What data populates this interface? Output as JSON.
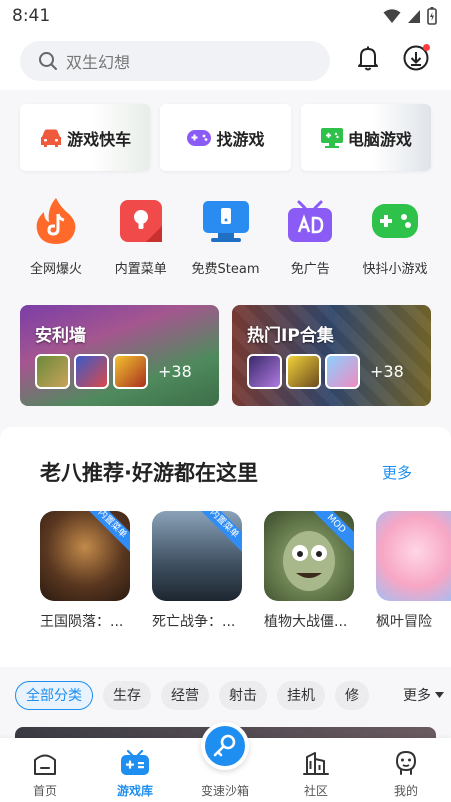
{
  "status_bar": {
    "time": "8:41"
  },
  "search": {
    "placeholder": "双生幻想"
  },
  "feature_cards": [
    {
      "label": "游戏快车",
      "icon": "car-icon",
      "color": "#f05a3c"
    },
    {
      "label": "找游戏",
      "icon": "gamepad-icon",
      "color": "#8a5cf5"
    },
    {
      "label": "电脑游戏",
      "icon": "monitor-gamepad-icon",
      "color": "#2ec24a"
    }
  ],
  "quick_links": [
    {
      "label": "全网爆火",
      "icon": "tiktok-flame-icon",
      "color": "#ff6a2a"
    },
    {
      "label": "内置菜单",
      "icon": "menu-bulb-icon",
      "color": "#f04a4a"
    },
    {
      "label": "免费Steam",
      "icon": "steam-monitor-icon",
      "color": "#2a8cf0"
    },
    {
      "label": "免广告",
      "icon": "no-ads-icon",
      "color": "#8a5cf5"
    },
    {
      "label": "快抖小游戏",
      "icon": "mini-game-icon",
      "color": "#2ec24a"
    }
  ],
  "banners": [
    {
      "title": "安利墙",
      "count": "+38"
    },
    {
      "title": "热门IP合集",
      "count": "+38"
    }
  ],
  "recommend": {
    "title": "老八推荐·好游都在这里",
    "more": "更多",
    "games": [
      {
        "name": "王国陨落：...",
        "badge": "内置菜单"
      },
      {
        "name": "死亡战争：...",
        "badge": "内置菜单"
      },
      {
        "name": "植物大战僵...",
        "badge": "MOD"
      },
      {
        "name": "枫叶冒险",
        "badge": ""
      }
    ]
  },
  "categories": {
    "items": [
      "全部分类",
      "生存",
      "经营",
      "射击",
      "挂机",
      "修"
    ],
    "active": "全部分类",
    "more": "更多"
  },
  "bottom_nav": {
    "items": [
      {
        "label": "首页",
        "icon": "home-icon"
      },
      {
        "label": "游戏库",
        "icon": "game-library-icon"
      },
      {
        "label": "变速沙箱",
        "icon": "key-icon"
      },
      {
        "label": "社区",
        "icon": "community-building-icon"
      },
      {
        "label": "我的",
        "icon": "profile-icon"
      }
    ],
    "active": "游戏库",
    "accent": "#1e8ff0"
  }
}
